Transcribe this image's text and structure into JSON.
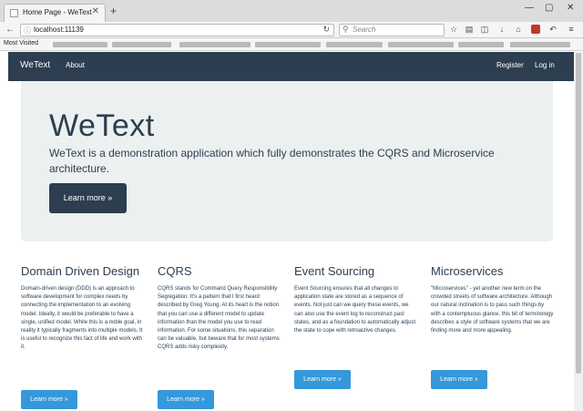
{
  "browser": {
    "tab_title": "Home Page - WeText",
    "tab_close": "✕",
    "new_tab": "+",
    "url": "localhost:11139",
    "search_placeholder": "Search",
    "window_controls": [
      "—",
      "▢",
      "✕"
    ],
    "bookmarks_first": "Most Visited"
  },
  "site": {
    "brand": "WeText",
    "nav_left": [
      "About"
    ],
    "nav_right": [
      "Register",
      "Log in"
    ]
  },
  "jumbotron": {
    "heading": "WeText",
    "lead": "WeText is a demonstration application which fully demonstrates the CQRS and Microservice architecture.",
    "button": "Learn more »"
  },
  "columns": [
    {
      "title": "Domain Driven Design",
      "text": "Domain-driven design (DDD) is an approach to software development for complex needs by connecting the implementation to an evolving model. Ideally, it would be preferable to have a single, unified model. While this is a noble goal, in reality it typically fragments into multiple models. It is useful to recognize this fact of life and work with it.",
      "button": "Learn more »"
    },
    {
      "title": "CQRS",
      "text": "CQRS stands for Command Query Responsibility Segregation. It's a pattern that I first heard described by Greg Young. At its heart is the notion that you can use a different model to update information than the model you use to read information. For some situations, this separation can be valuable, but beware that for most systems CQRS adds risky complexity.",
      "button": "Learn more »"
    },
    {
      "title": "Event Sourcing",
      "text": "Event Sourcing ensures that all changes to application state are stored as a sequence of events. Not just can we query these events, we can also use the event log to reconstruct past states, and as a foundation to automatically adjust the state to cope with retroactive changes.",
      "button": "Learn more »"
    },
    {
      "title": "Microservices",
      "text": "\"Microservices\" - yet another new term on the crowded streets of software architecture. Although our natural inclination is to pass such things by with a contemptuous glance, this bit of terminology describes a style of software systems that we are finding more and more appealing.",
      "button": "Learn more »"
    }
  ],
  "colors": {
    "navbar": "#2c3e50",
    "jumbotron_bg": "#ecf0f1",
    "info_button": "#3498db"
  }
}
